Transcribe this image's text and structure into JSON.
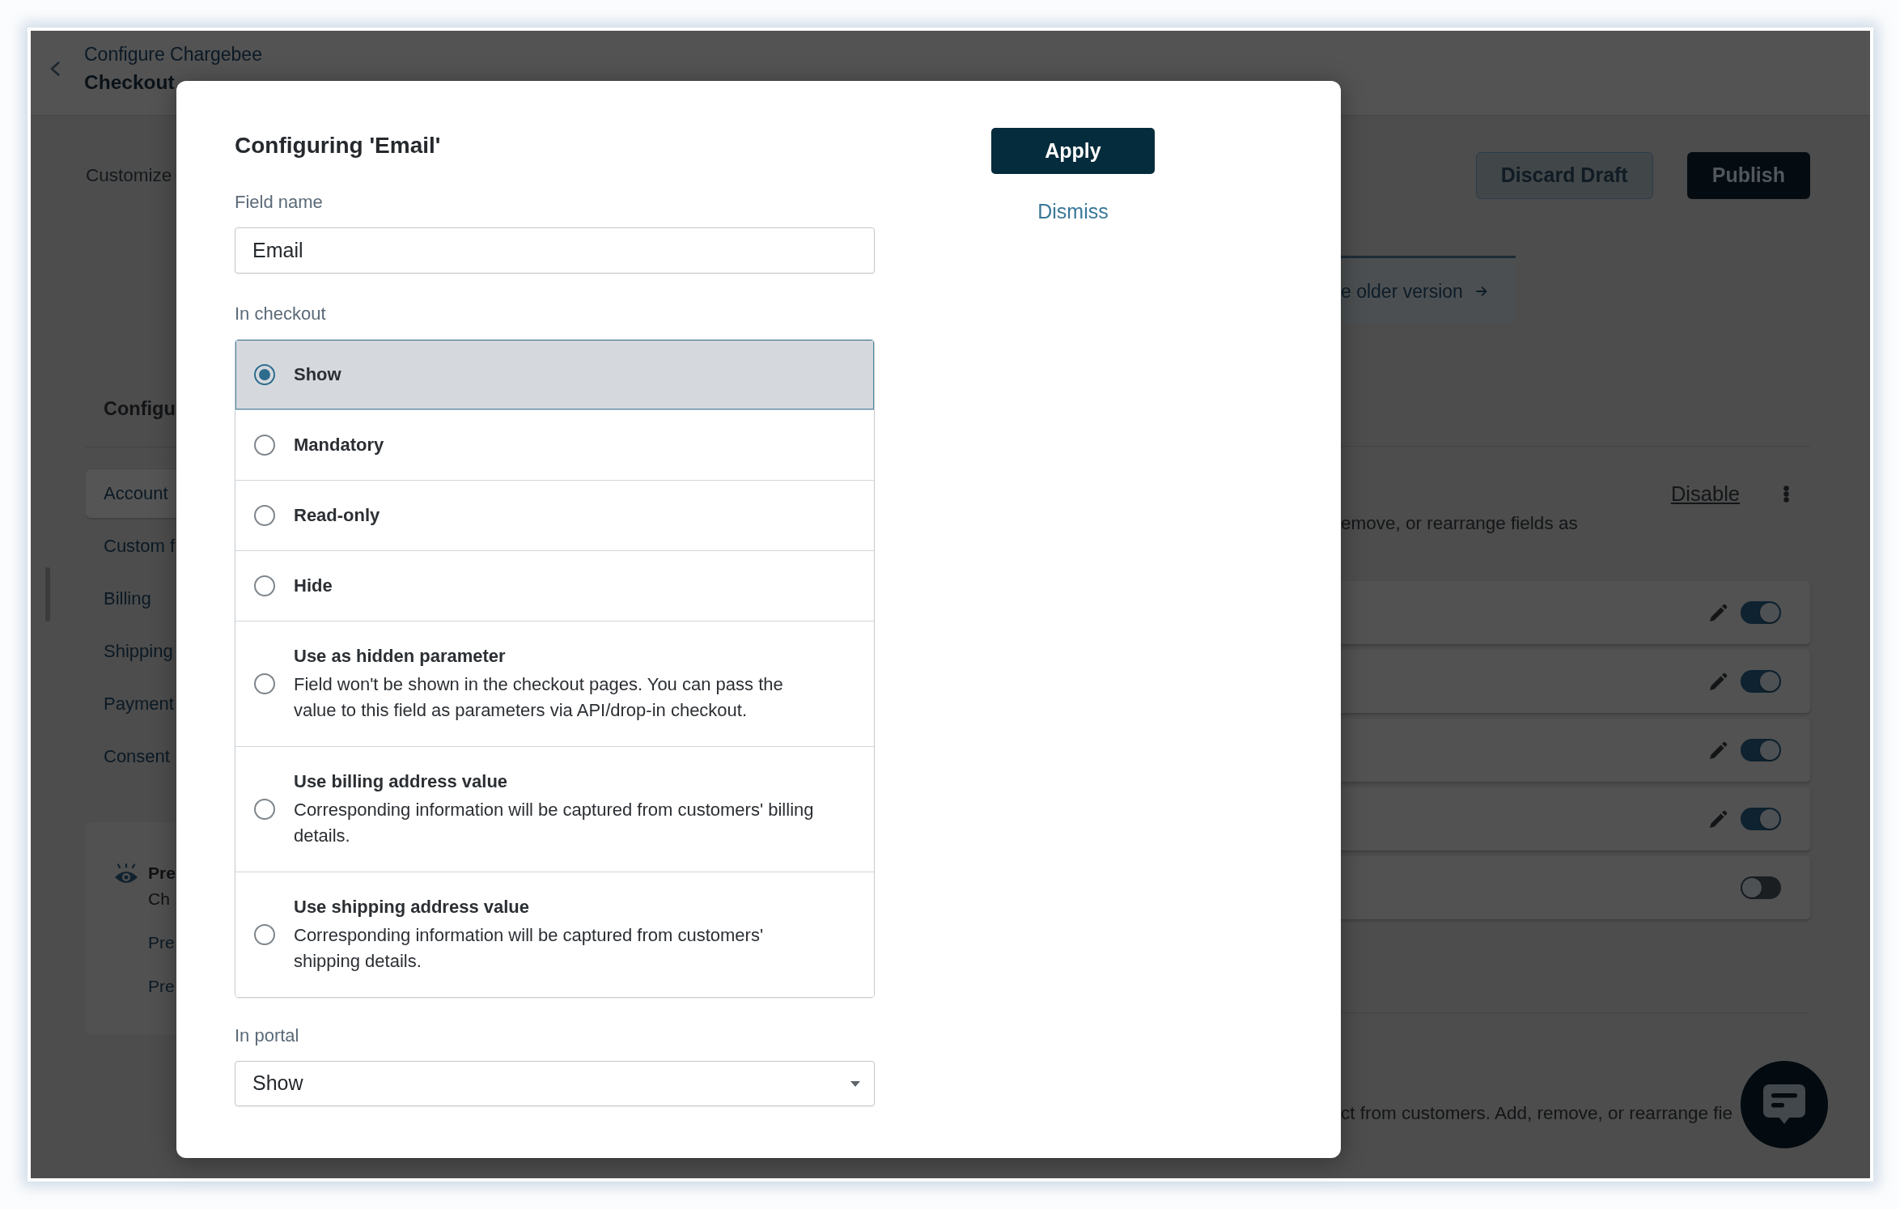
{
  "header": {
    "breadcrumb": "Configure Chargebee",
    "title": "Checkout"
  },
  "toolbar": {
    "subtitle": "Customize",
    "buttons": [
      {
        "label": "Discard Draft",
        "kind": "secondary"
      },
      {
        "label": "Publish",
        "kind": "primary"
      }
    ]
  },
  "sidebar": {
    "title": "Configu",
    "items": [
      {
        "label": "Account",
        "selected": true
      },
      {
        "label": "Custom f",
        "selected": false
      },
      {
        "label": "Billing",
        "selected": false
      },
      {
        "label": "Shipping",
        "selected": false
      },
      {
        "label": "Payment",
        "selected": false
      },
      {
        "label": "Consent",
        "selected": false
      }
    ]
  },
  "preview": {
    "title": "Pre",
    "text": "Ch",
    "links": [
      "Pre",
      "Pre"
    ]
  },
  "content": {
    "tab_link": "e older version",
    "section_action": "Disable",
    "section_text": "emove, or rearrange fields as",
    "fields": [
      {
        "editable": true,
        "on": true
      },
      {
        "editable": true,
        "on": true
      },
      {
        "editable": true,
        "on": true
      },
      {
        "editable": true,
        "on": true
      },
      {
        "editable": false,
        "on": false
      }
    ],
    "section_2_text": "ct from customers. Add, remove, or rearrange fie"
  },
  "dialog": {
    "title": "Configuring 'Email'",
    "field_name": {
      "label": "Field name",
      "value": "Email"
    },
    "in_checkout": {
      "label": "In checkout",
      "options": [
        {
          "label": "Show",
          "selected": true
        },
        {
          "label": "Mandatory",
          "selected": false
        },
        {
          "label": "Read-only",
          "selected": false
        },
        {
          "label": "Hide",
          "selected": false
        },
        {
          "label": "Use as hidden parameter",
          "description": "Field won't be shown in the checkout pages. You can pass the value to this field as parameters via API/drop-in checkout.",
          "selected": false
        },
        {
          "label": "Use billing address value",
          "description": "Corresponding information will be captured from customers' billing details.",
          "selected": false
        },
        {
          "label": "Use shipping address value",
          "description": "Corresponding information will be captured from customers' shipping details.",
          "selected": false
        }
      ]
    },
    "in_portal": {
      "label": "In portal",
      "value": "Show"
    },
    "buttons": [
      {
        "label": "Apply",
        "kind": "primary"
      },
      {
        "label": "Dismiss",
        "kind": "link"
      }
    ]
  }
}
